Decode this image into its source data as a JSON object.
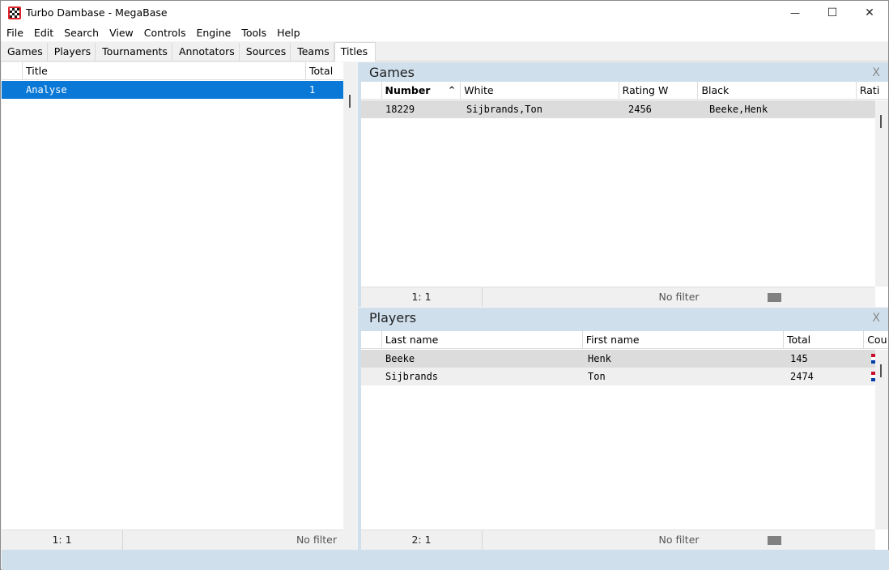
{
  "window": {
    "title": "Turbo Dambase - MegaBase",
    "minimize_glyph": "—",
    "maximize_glyph": "☐",
    "close_glyph": "✕"
  },
  "menu": [
    "File",
    "Edit",
    "Search",
    "View",
    "Controls",
    "Engine",
    "Tools",
    "Help"
  ],
  "tabs": [
    "Games",
    "Players",
    "Tournaments",
    "Annotators",
    "Sources",
    "Teams",
    "Titles"
  ],
  "active_tab": "Titles",
  "titles_grid": {
    "columns": [
      "Title",
      "Total"
    ],
    "rows": [
      {
        "title": "Analyse",
        "total": "1"
      }
    ],
    "status_count": "1: 1",
    "status_filter": "No filter"
  },
  "games_panel": {
    "title": "Games",
    "close_label": "X",
    "columns": [
      "Number",
      "White",
      "Rating W",
      "Black",
      "Rati"
    ],
    "sort_indicator": "^",
    "rows": [
      {
        "number": "18229",
        "white": "Sijbrands,Ton",
        "rating_w": "2456",
        "black": "Beeke,Henk"
      }
    ],
    "status_count": "1: 1",
    "status_filter": "No filter"
  },
  "players_panel": {
    "title": "Players",
    "close_label": "X",
    "columns": [
      "Last name",
      "First name",
      "Total",
      "Cou"
    ],
    "rows": [
      {
        "last": "Beeke",
        "first": "Henk",
        "total": "145"
      },
      {
        "last": "Sijbrands",
        "first": "Ton",
        "total": "2474"
      }
    ],
    "status_count": "2: 1",
    "status_filter": "No filter"
  },
  "colors": {
    "selection": "#0a78d7",
    "panel_background": "#cfdfec",
    "row_grey": "#dcdcdc"
  }
}
